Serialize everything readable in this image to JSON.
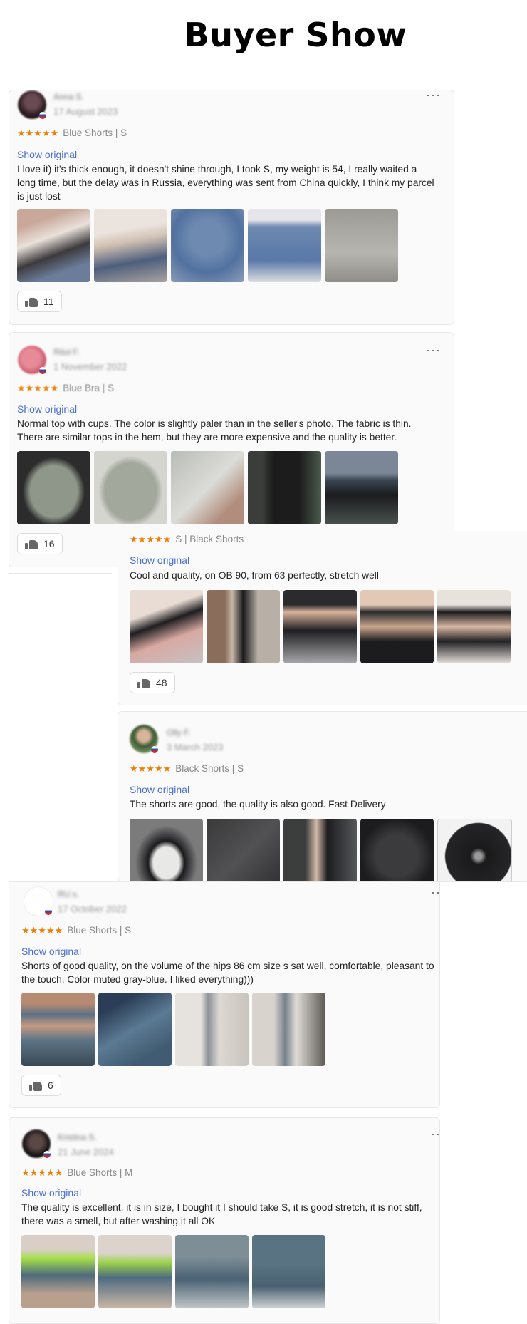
{
  "page": {
    "title": "Buyer Show"
  },
  "more_label": "···",
  "more_short": "··",
  "stars": "★★★★★",
  "reviews": [
    {
      "name": "Anna S.",
      "date": "17 August 2023",
      "variant": "Blue Shorts | S",
      "show_original": "Show original",
      "text": "I love it) it's thick enough, it doesn't shine through, I took S, my weight is 54, I really waited a long time, but the delay was in Russia, everything was sent from China quickly, I think my parcel is just lost",
      "likes": "11"
    },
    {
      "name": "Ritul F.",
      "date": "1 November 2022",
      "variant": "Blue Bra | S",
      "show_original": "Show original",
      "text": "Normal top with cups. The color is slightly paler than in the seller's photo. The fabric is thin. There are similar tops in the hem, but they are more expensive and the quality is better.",
      "likes": "16"
    },
    {
      "variant": "S | Black Shorts",
      "show_original": "Show original",
      "text": "Cool and quality, on OB 90, from 63 perfectly, stretch well",
      "likes": "48"
    },
    {
      "name": "Olly F.",
      "date": "3 March 2023",
      "variant": "Black Shorts | S",
      "show_original": "Show original",
      "text": "The shorts are good, the quality is also good. Fast Delivery"
    },
    {
      "name": "RU s.",
      "date": "17 October 2022",
      "variant": "Blue Shorts | S",
      "show_original": "Show original",
      "text": "Shorts of good quality, on the volume of the hips 86 cm size s sat well, comfortable, pleasant to the touch. Color muted gray-blue. I liked everything)))",
      "likes": "6"
    },
    {
      "name": "Kristina S.",
      "date": "21 June 2024",
      "variant": "Blue Shorts | M",
      "show_original": "Show original",
      "text": "The quality is excellent, it is in size, I bought it I should take S, it is good stretch, it is not stiff, there was a smell, but after washing it all OK"
    }
  ],
  "colors": {
    "star": "#f07c00",
    "link": "#4a6fd0"
  }
}
